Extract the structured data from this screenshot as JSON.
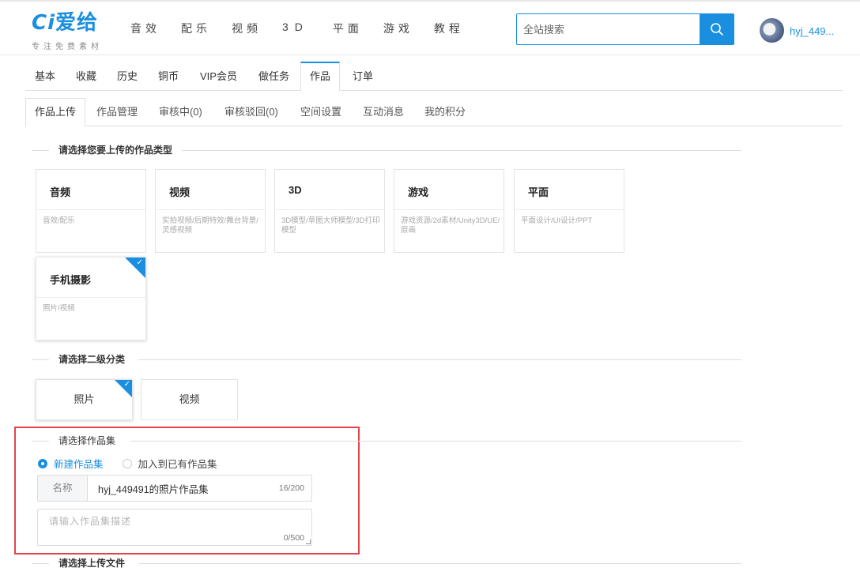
{
  "header": {
    "logo_text": "爱给",
    "logo_mark": "Ci",
    "tagline": "专注免费素材",
    "nav": [
      "音效",
      "配乐",
      "视频",
      "3D",
      "平面",
      "游戏",
      "教程"
    ],
    "search_placeholder": "全站搜索",
    "username": "hyj_449..."
  },
  "tabs_primary": [
    "基本",
    "收藏",
    "历史",
    "铜币",
    "VIP会员",
    "做任务",
    "作品",
    "订单"
  ],
  "tabs_primary_active": "作品",
  "tabs_secondary": [
    "作品上传",
    "作品管理",
    "审核中(0)",
    "审核驳回(0)",
    "空间设置",
    "互动消息",
    "我的积分"
  ],
  "tabs_secondary_active": "作品上传",
  "section_type_title": "请选择您要上传的作品类型",
  "work_types": [
    {
      "title": "音频",
      "desc": "音效/配乐",
      "selected": false
    },
    {
      "title": "视频",
      "desc": "实拍视频/后期特效/舞台背景/灵感视频",
      "selected": false
    },
    {
      "title": "3D",
      "desc": "3D模型/草图大师模型/3D打印模型",
      "selected": false
    },
    {
      "title": "游戏",
      "desc": "游戏资源/2d素材/Unity3D/UE/原画",
      "selected": false
    },
    {
      "title": "平面",
      "desc": "平面设计/UI设计/PPT",
      "selected": false
    },
    {
      "title": "手机摄影",
      "desc": "照片/视频",
      "selected": true
    }
  ],
  "section_sub_title": "请选择二级分类",
  "sub_categories": [
    {
      "label": "照片",
      "selected": true
    },
    {
      "label": "视频",
      "selected": false
    }
  ],
  "section_collection_title": "请选择作品集",
  "collection": {
    "option_new": "新建作品集",
    "option_existing": "加入到已有作品集",
    "selected": "new",
    "name_label": "名称",
    "name_value": "hyj_449491的照片作品集",
    "name_count": "16/200",
    "desc_placeholder": "请输入作品集描述",
    "desc_count": "0/500"
  },
  "section_file_title": "请选择上传文件",
  "colors": {
    "accent": "#1a8fe0",
    "highlight": "#e5434b"
  }
}
